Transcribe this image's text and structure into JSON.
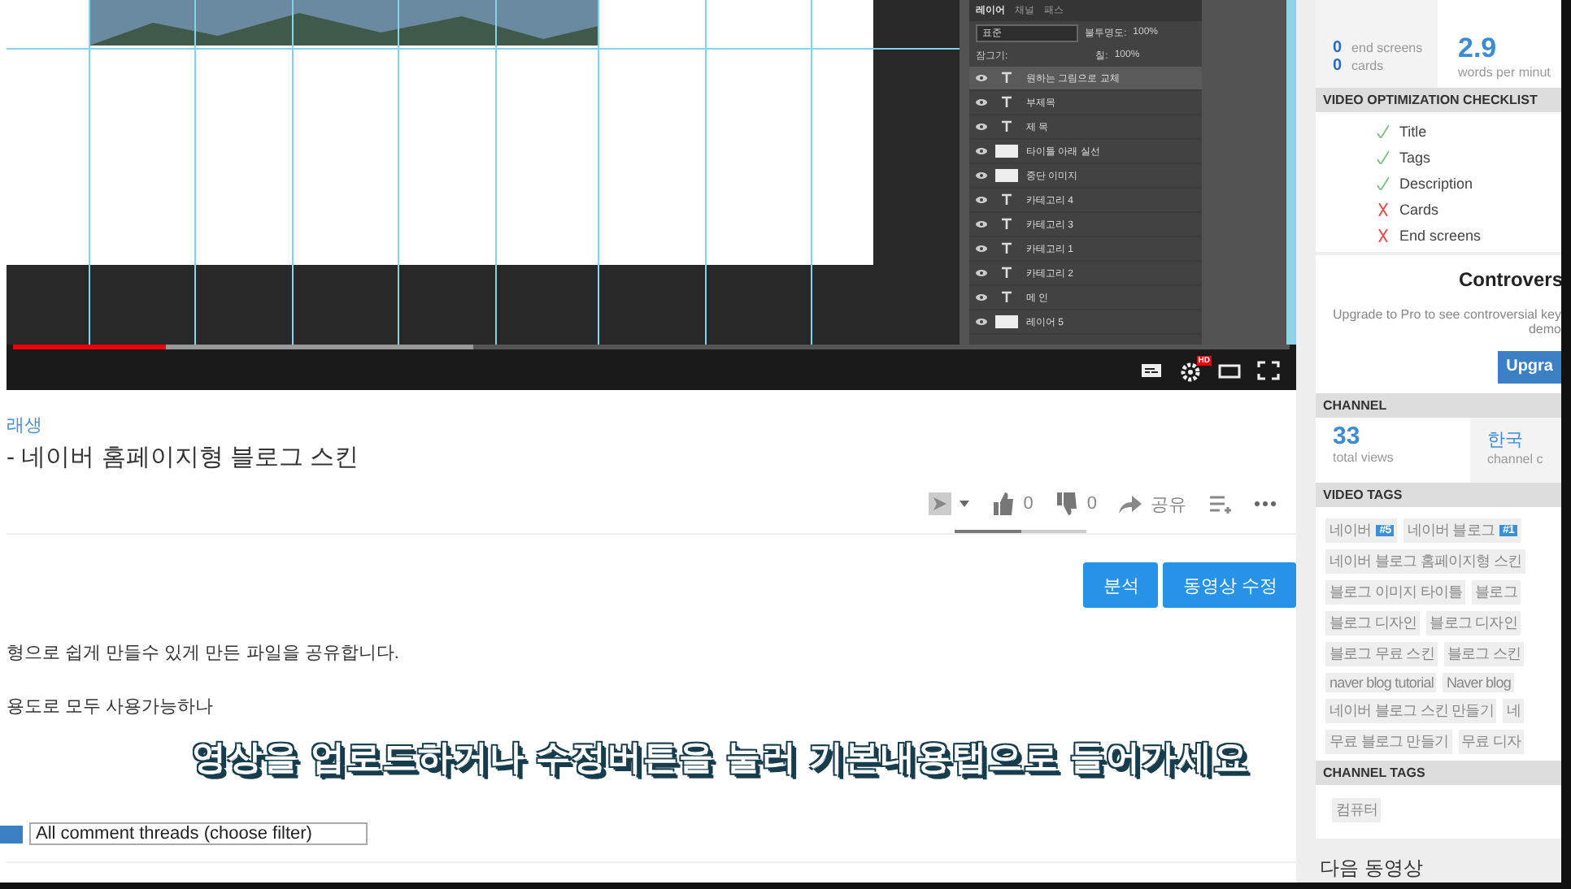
{
  "video": {
    "layers_panel": {
      "tabs": [
        {
          "label": "레이어",
          "selected": true
        },
        {
          "label": "채널",
          "selected": false
        },
        {
          "label": "패스",
          "selected": false
        }
      ],
      "blend_mode": "표준",
      "opacity_label": "불투명도:",
      "opacity": "100%",
      "lock_label": "잠그기:",
      "fill_label": "칠:",
      "fill": "100%",
      "layers": [
        {
          "name": "원하는 그림으로 교체",
          "kind": "text",
          "selected": true
        },
        {
          "name": "부제목",
          "kind": "text",
          "selected": false
        },
        {
          "name": "제 목",
          "kind": "text",
          "selected": false
        },
        {
          "name": "타이틀 아래 실선",
          "kind": "image",
          "selected": false
        },
        {
          "name": "중단 이미지",
          "kind": "image",
          "selected": false
        },
        {
          "name": "카테고리 4",
          "kind": "text",
          "selected": false
        },
        {
          "name": "카테고리 3",
          "kind": "text",
          "selected": false
        },
        {
          "name": "카테고리 1",
          "kind": "text",
          "selected": false
        },
        {
          "name": "카테고리 2",
          "kind": "text",
          "selected": false
        },
        {
          "name": "메 인",
          "kind": "text",
          "selected": false
        },
        {
          "name": "레이어 5",
          "kind": "image",
          "selected": false
        }
      ]
    },
    "progress": {
      "level": 0.12
    },
    "hd_badge": "HD"
  },
  "channel_link": "래생",
  "title": "- 네이버 홈페이지형 블로그 스킨",
  "actions": {
    "likes": "0",
    "dislikes": "0",
    "share": "공유",
    "sentiment": {
      "level": 0.5
    }
  },
  "buttons": [
    {
      "label": "분석"
    },
    {
      "label": "동영상 수정"
    }
  ],
  "description": [
    "형으로 쉽게 만들수 있게 만든 파일을 공유합니다.",
    "용도로 모두 사용가능하나"
  ],
  "comment_filter": {
    "value": "All comment threads (choose filter)"
  },
  "caption": "영상을 업로드하거나 수정버튼을 눌러 기본내용탭으로 들어가세요",
  "sidebar": {
    "stats": {
      "end_screens": "0",
      "end_screens_label": "end screens",
      "cards": "0",
      "cards_label": "cards",
      "wpm": "2.9",
      "wpm_label": "words per minut"
    },
    "checklist_header": "VIDEO OPTIMIZATION CHECKLIST",
    "checklist": [
      {
        "label": "Title",
        "checked": true
      },
      {
        "label": "Tags",
        "checked": true
      },
      {
        "label": "Description",
        "checked": true
      },
      {
        "label": "Cards",
        "checked": false
      },
      {
        "label": "End screens",
        "checked": false
      }
    ],
    "controversial": {
      "title": "Controvers",
      "text_1": "Upgrade to Pro to see controversial key",
      "text_2": "demo",
      "button": "Upgra"
    },
    "channel_header": "CHANNEL",
    "channel": {
      "views": "33",
      "views_label": "total views",
      "country": "한국",
      "country_label": "channel c"
    },
    "tags_header": "VIDEO TAGS",
    "tag_rows": [
      [
        {
          "label": "네이버",
          "badge": "#5"
        },
        {
          "label": "네이버 블로그",
          "badge": "#1"
        }
      ],
      [
        {
          "label": "네이버 블로그 홈페이지형 스킨"
        }
      ],
      [
        {
          "label": "블로그 이미지 타이틀"
        },
        {
          "label": "블로그"
        }
      ],
      [
        {
          "label": "블로그 디자인"
        },
        {
          "label": "블로그 디자인"
        }
      ],
      [
        {
          "label": "블로그 무료 스킨"
        },
        {
          "label": "블로그 스킨"
        }
      ],
      [
        {
          "label": "naver blog tutorial"
        },
        {
          "label": "Naver blog"
        }
      ],
      [
        {
          "label": "네이버 블로그 스킨 만들기"
        },
        {
          "label": "네"
        }
      ],
      [
        {
          "label": "무료 블로그 만들기"
        },
        {
          "label": "무료 디자"
        }
      ]
    ],
    "channel_tags_header": "CHANNEL TAGS",
    "channel_tags": [
      {
        "label": "컴퓨터"
      }
    ],
    "up_next": "다음 동영상"
  }
}
